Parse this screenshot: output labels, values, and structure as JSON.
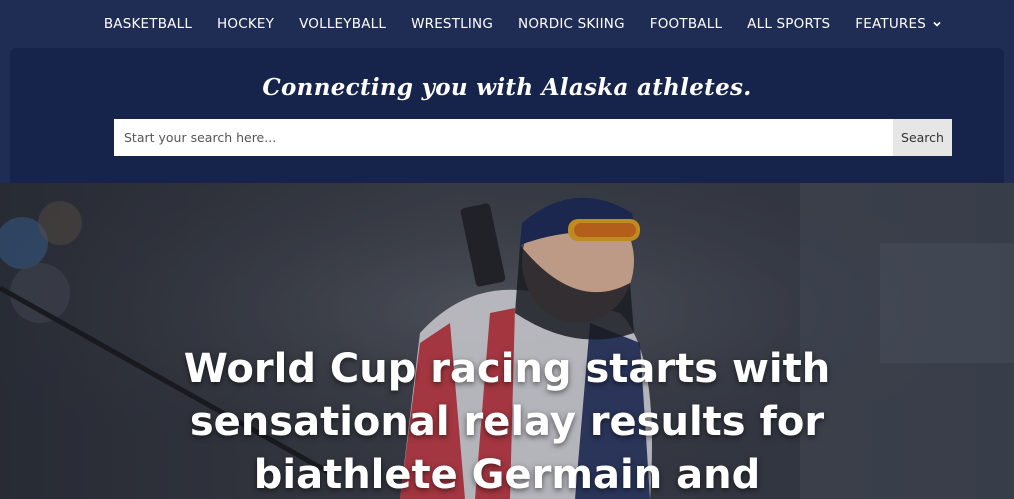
{
  "nav": {
    "items": [
      {
        "label": "BASKETBALL"
      },
      {
        "label": "HOCKEY"
      },
      {
        "label": "VOLLEYBALL"
      },
      {
        "label": "WRESTLING"
      },
      {
        "label": "NORDIC SKIING"
      },
      {
        "label": "FOOTBALL"
      },
      {
        "label": "ALL SPORTS"
      },
      {
        "label": "FEATURES",
        "icon": "chevron-down-icon"
      }
    ]
  },
  "search": {
    "tagline": "Connecting you with Alaska athletes.",
    "placeholder": "Start your search here...",
    "button_label": "Search"
  },
  "hero": {
    "headline": "World Cup racing starts with sensational relay results for biathlete Germain and"
  },
  "colors": {
    "nav_bg": "#1f2d55",
    "band_bg": "#16234a",
    "search_button_bg": "#e6e6e6"
  }
}
